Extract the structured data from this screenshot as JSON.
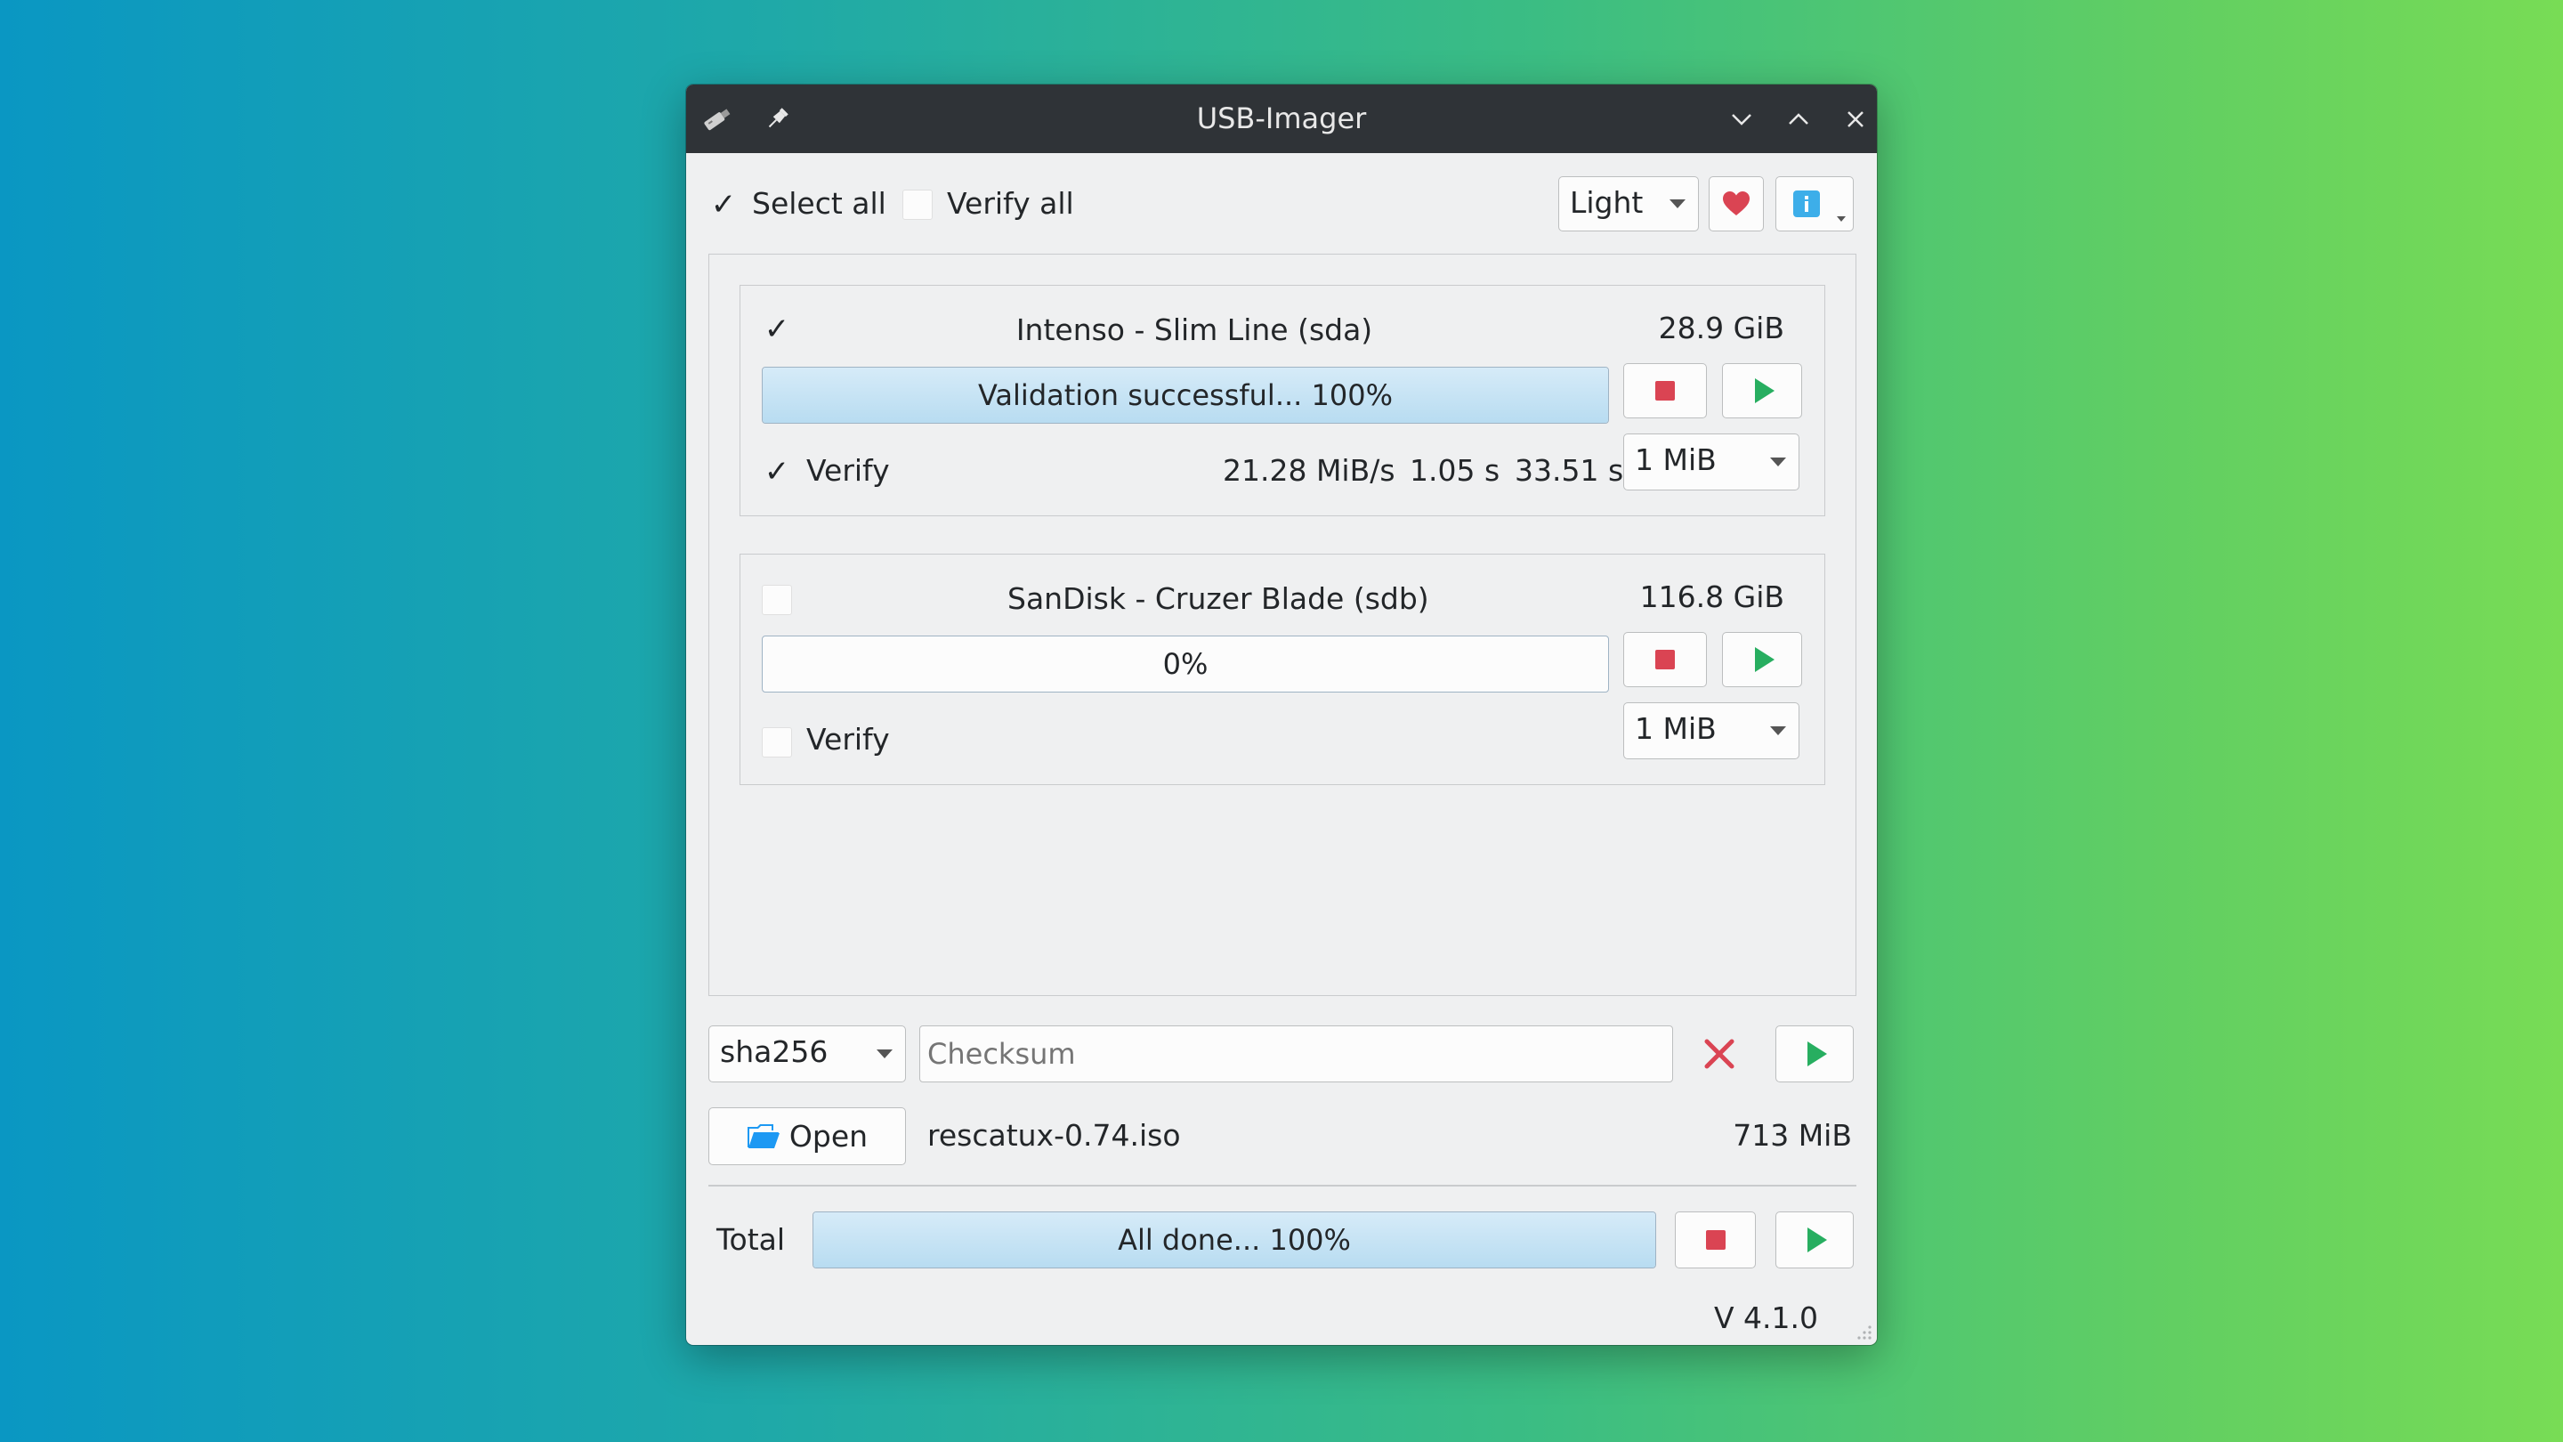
{
  "window": {
    "title": "USB-Imager"
  },
  "top": {
    "select_all_label": "Select all",
    "select_all_checked": true,
    "verify_all_label": "Verify all",
    "verify_all_checked": false,
    "theme_value": "Light",
    "donate_icon": "heart-icon",
    "info_icon": "info-icon"
  },
  "devices": [
    {
      "name": "Intenso - Slim Line (sda)",
      "size": "28.9 GiB",
      "checked": true,
      "progress_text": "Validation successful... 100%",
      "progress_fraction": 1.0,
      "verify_label": "Verify",
      "verify_checked": true,
      "speed": "21.28 MiB/s",
      "time_elapsed": "1.05 s",
      "time_total": "33.51 s",
      "buffer": "1 MiB"
    },
    {
      "name": "SanDisk - Cruzer Blade (sdb)",
      "size": "116.8 GiB",
      "checked": false,
      "progress_text": "0%",
      "progress_fraction": 0.0,
      "verify_label": "Verify",
      "verify_checked": false,
      "buffer": "1 MiB"
    }
  ],
  "checksum": {
    "algorithm": "sha256",
    "placeholder": "Checksum",
    "value": ""
  },
  "file": {
    "open_label": "Open",
    "name": "rescatux-0.74.iso",
    "size": "713 MiB"
  },
  "total": {
    "label": "Total",
    "progress_text": "All done... 100%",
    "progress_fraction": 1.0
  },
  "version": "V 4.1.0",
  "colors": {
    "stop": "#da4453",
    "play": "#27ae60",
    "clear": "#da4453",
    "heart": "#da4453",
    "info": "#3daee9"
  }
}
